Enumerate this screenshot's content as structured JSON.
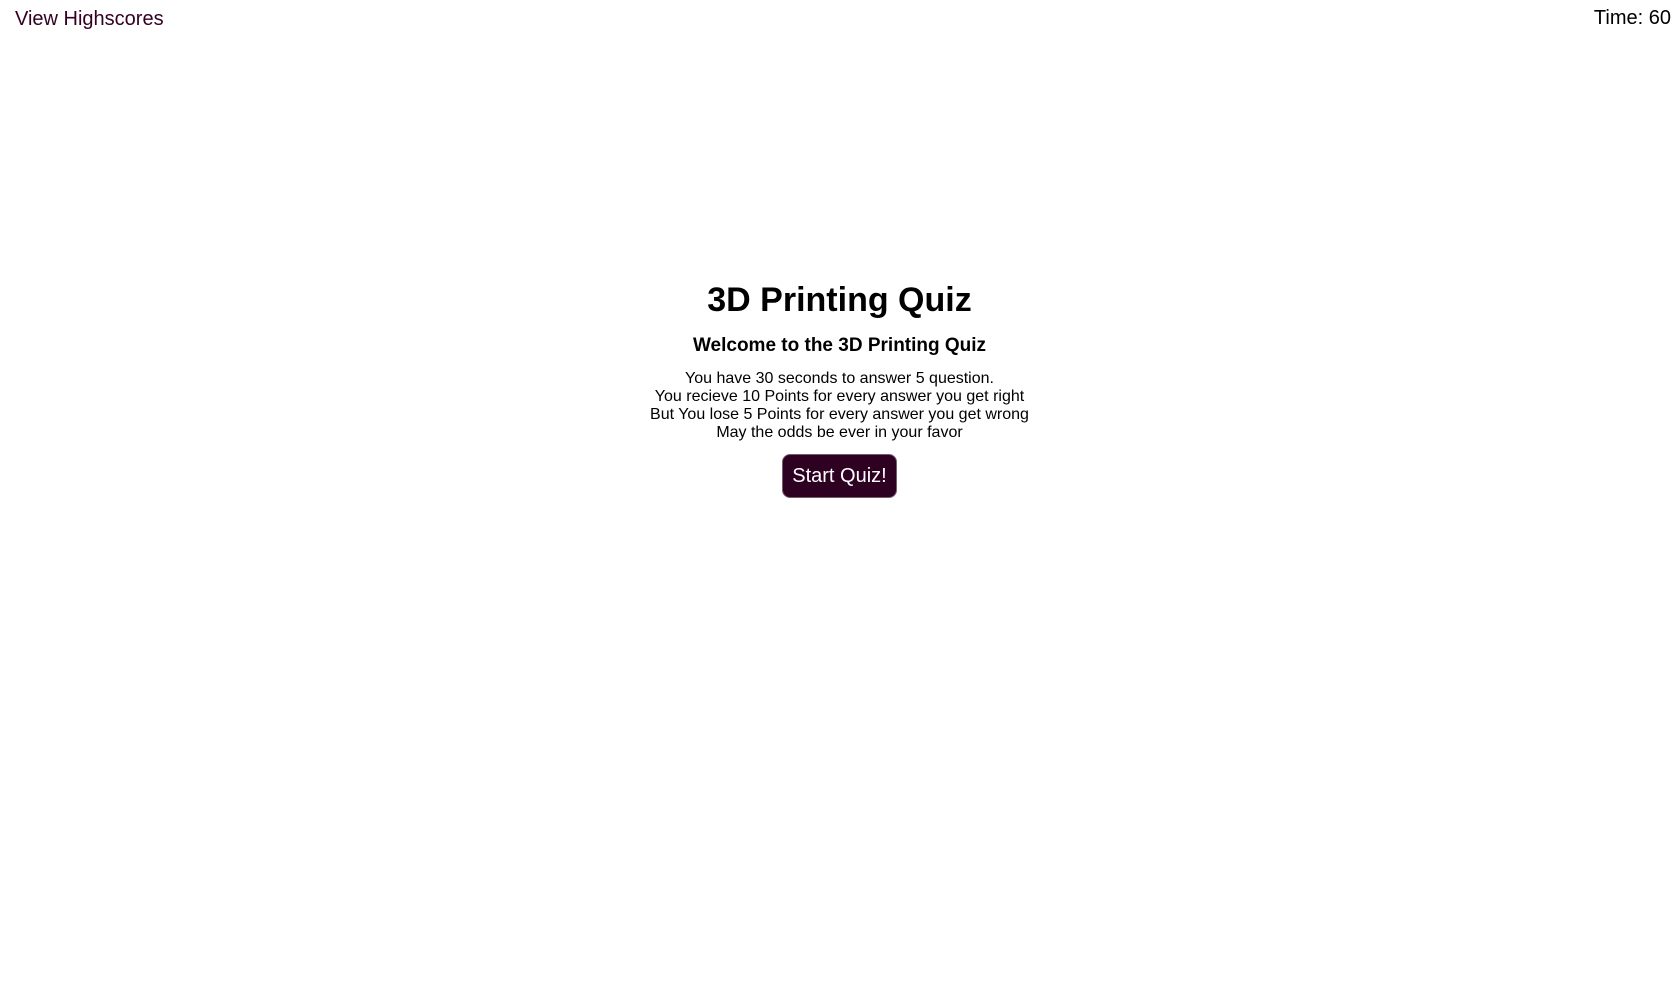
{
  "header": {
    "highscores_label": "View Highscores",
    "timer_label": "Time: ",
    "timer_value": "60"
  },
  "intro": {
    "title": "3D Printing Quiz",
    "subtitle": "Welcome to the 3D Printing Quiz",
    "instructions": [
      "You have 30 seconds to answer 5 question.",
      "You recieve 10 Points for every answer you get right",
      "But You lose 5 Points for every answer you get wrong",
      "May the odds be ever in your favor"
    ],
    "start_label": "Start Quiz!"
  },
  "colors": {
    "accent": "#2e0022",
    "link": "#330022",
    "background": "#ffffff"
  }
}
